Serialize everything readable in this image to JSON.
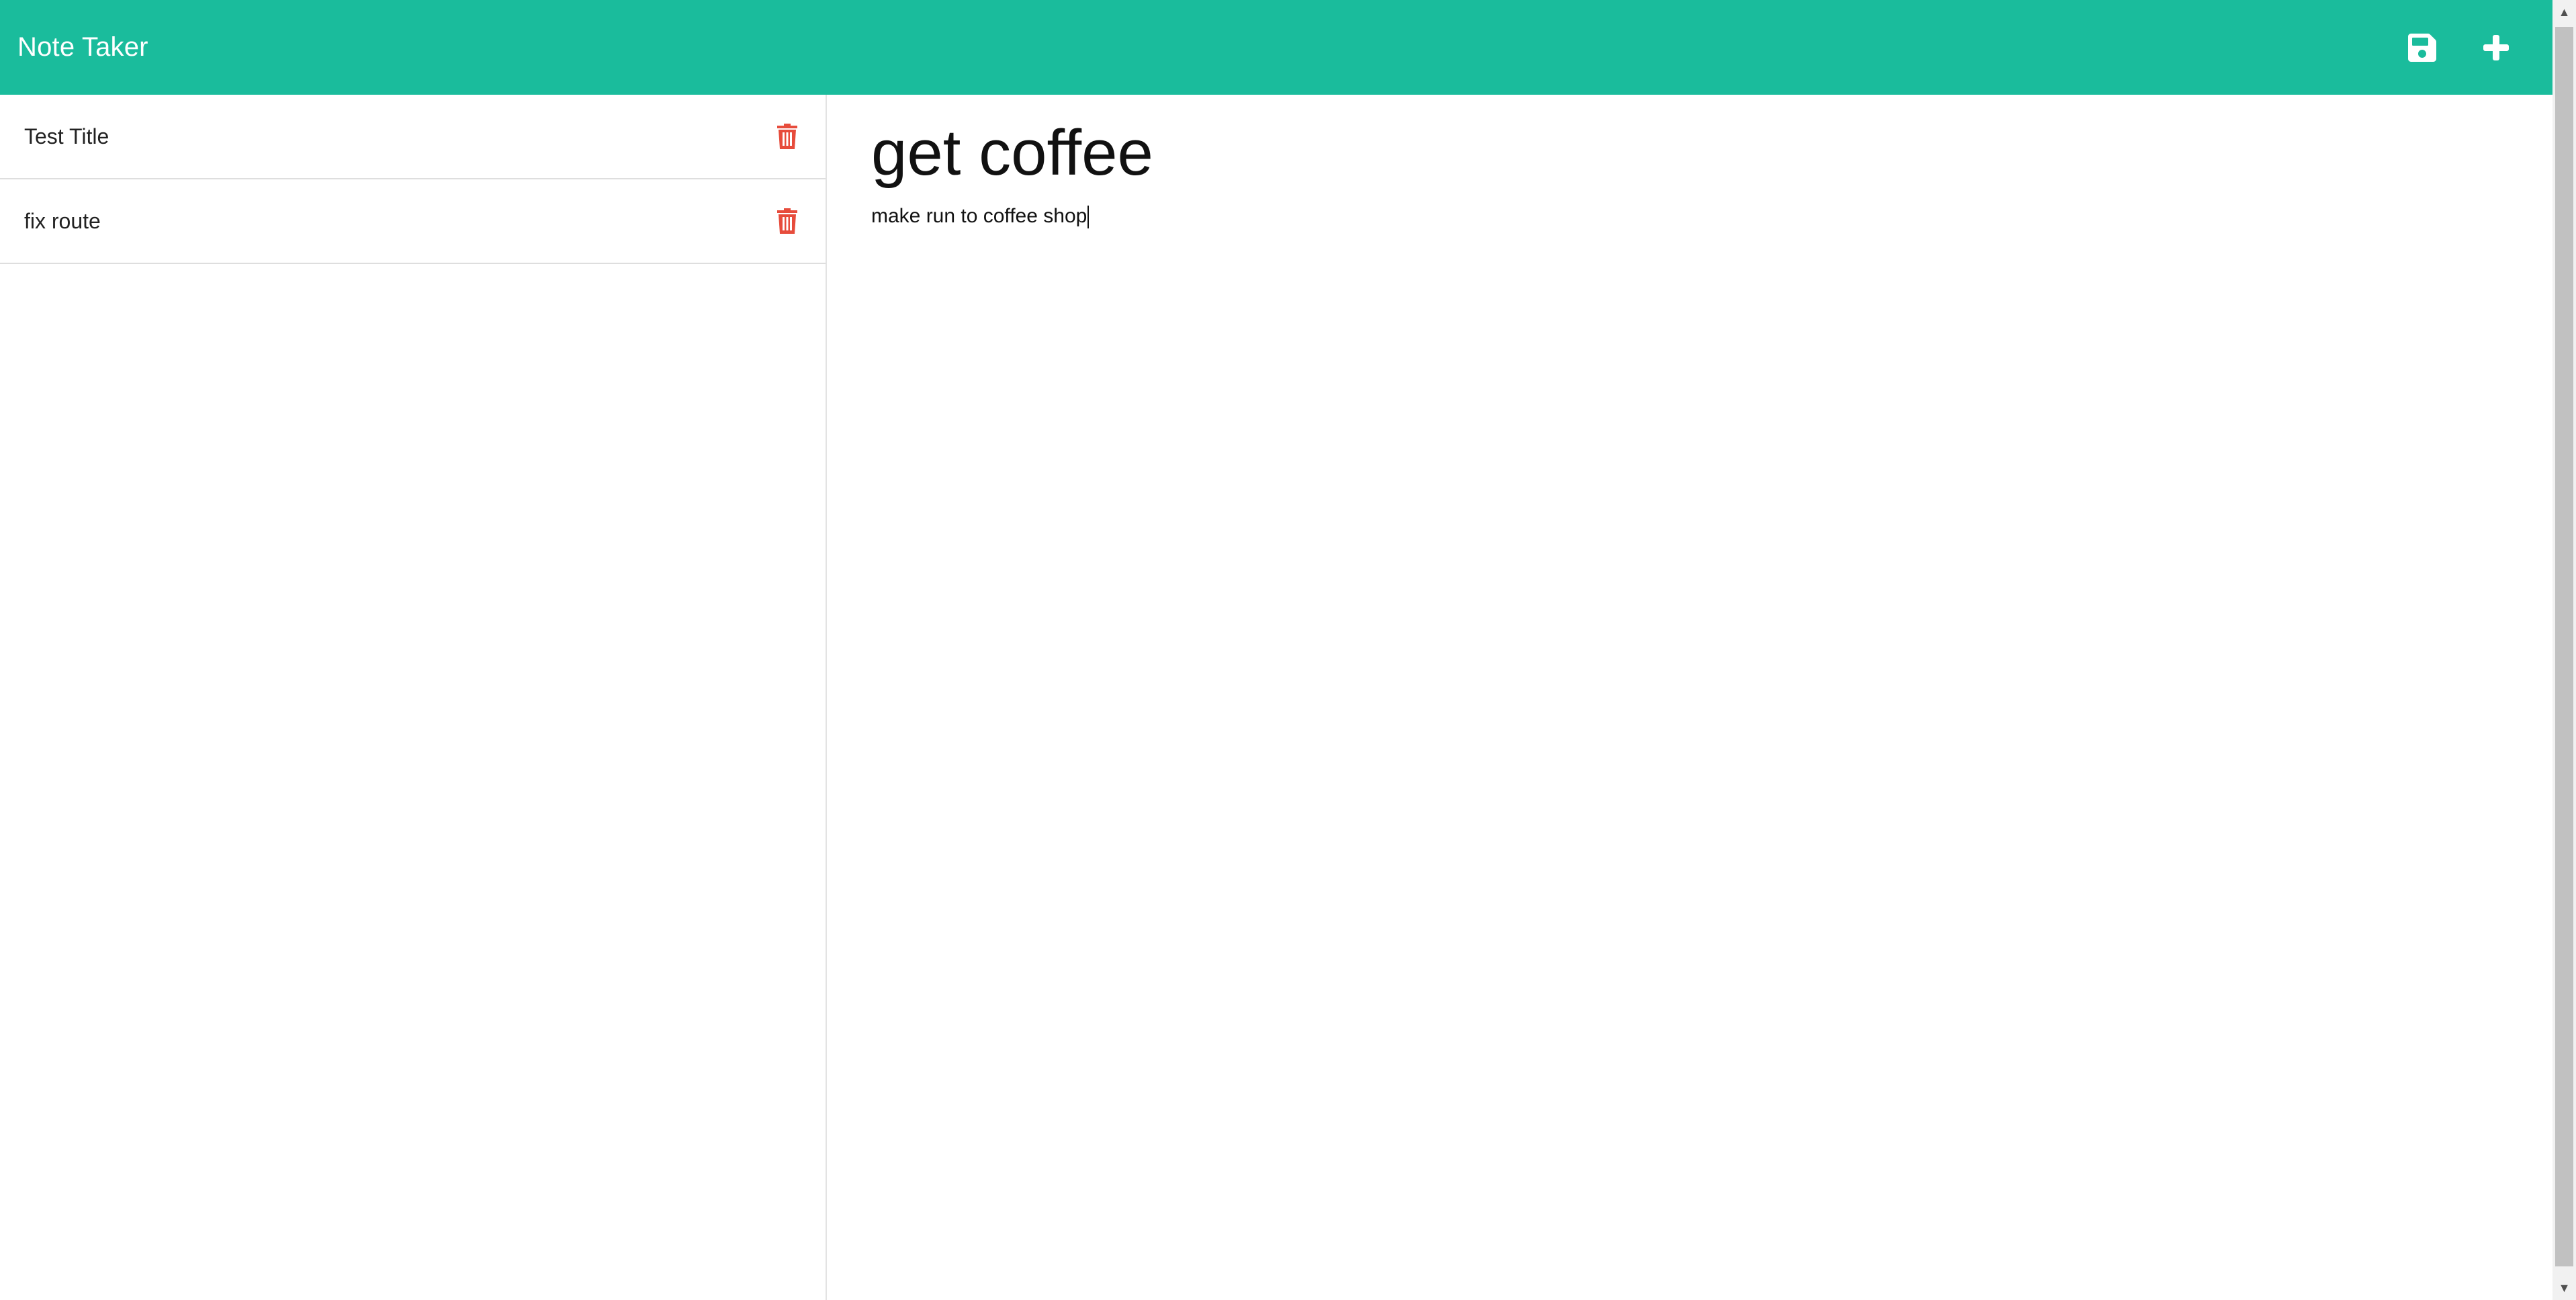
{
  "app": {
    "title": "Note Taker"
  },
  "toolbar": {
    "save_icon": "floppy-disk-icon",
    "new_icon": "plus-icon",
    "color": "#1abc9c",
    "icon_color": "#ffffff"
  },
  "sidebar": {
    "items": [
      {
        "label": "Test Title",
        "icon": "trash-icon"
      },
      {
        "label": "fix route",
        "icon": "trash-icon"
      }
    ],
    "delete_color": "#e74c3c"
  },
  "editor": {
    "title_value": "get coffee",
    "body_value": "make run to coffee shop"
  }
}
